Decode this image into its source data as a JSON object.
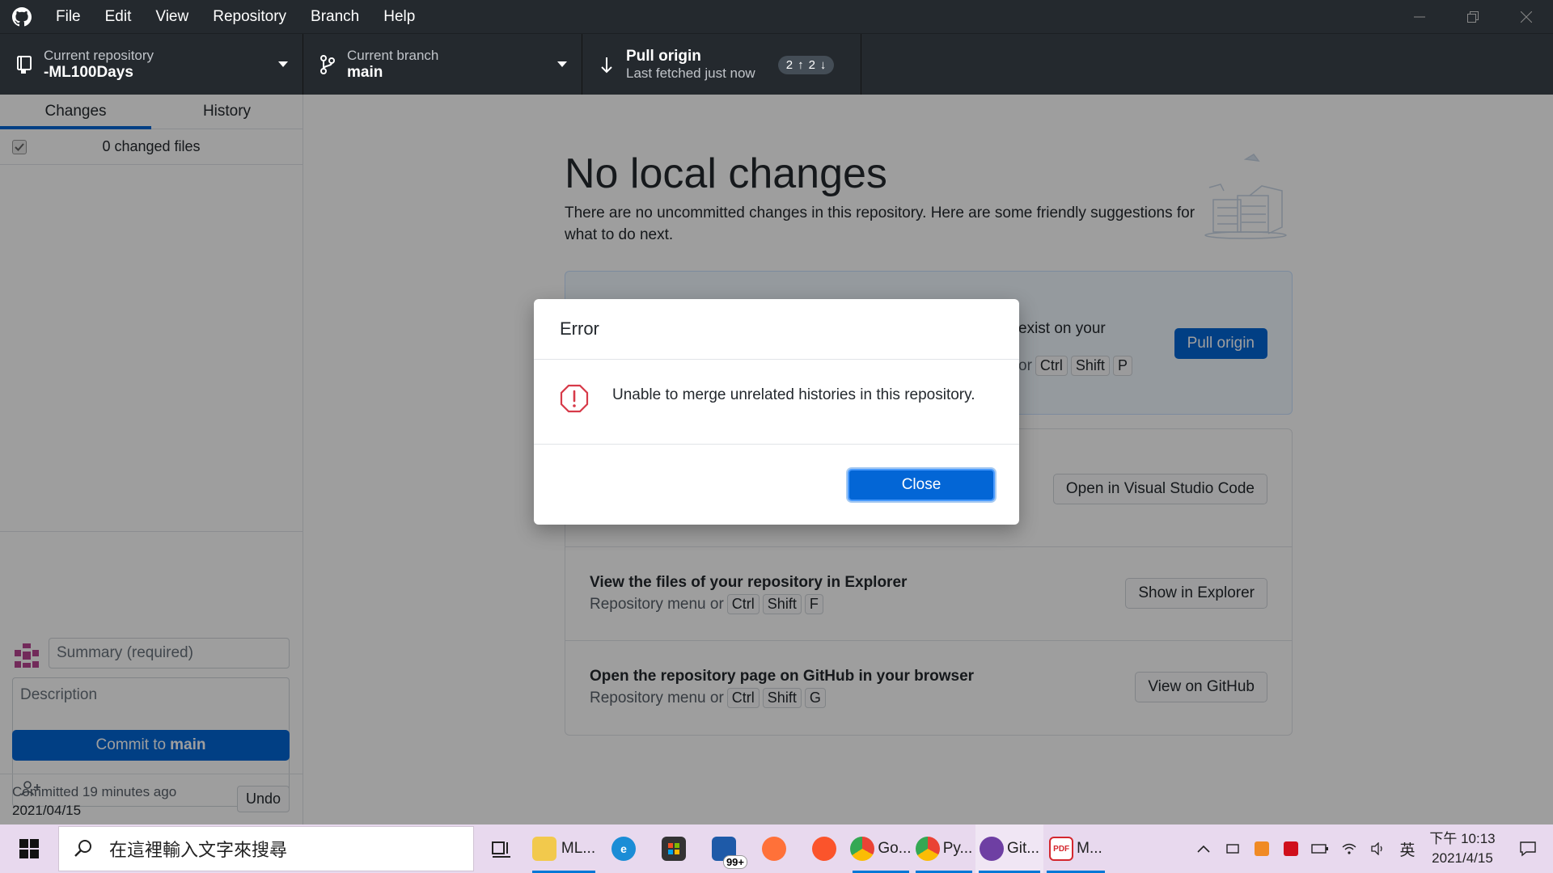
{
  "titlebar": {
    "menu": [
      "File",
      "Edit",
      "View",
      "Repository",
      "Branch",
      "Help"
    ]
  },
  "toolbar": {
    "repo_label": "Current repository",
    "repo_value": "-ML100Days",
    "branch_label": "Current branch",
    "branch_value": "main",
    "pull_label": "Pull origin",
    "pull_sub": "Last fetched just now",
    "ahead": "2",
    "behind": "2"
  },
  "sidebar": {
    "tabs": [
      "Changes",
      "History"
    ],
    "changed_files": "0 changed files",
    "summary_placeholder": "Summary (required)",
    "description_placeholder": "Description",
    "commit_prefix": "Commit to",
    "commit_branch": "main",
    "last_commit_text": "Committed 19 minutes ago",
    "last_commit_date": "2021/04/15",
    "undo_label": "Undo"
  },
  "main": {
    "title": "No local changes",
    "description": "There are no uncommitted changes in this repository. Here are some friendly suggestions for what to do next.",
    "pull_card": {
      "fragment": "exist on your",
      "or_text": "or",
      "keys": [
        "Ctrl",
        "Shift",
        "P"
      ],
      "button": "Pull origin"
    },
    "rows": [
      {
        "title": "",
        "sub_prefix": "",
        "keys": [],
        "button": "Open in Visual Studio Code"
      },
      {
        "title": "View the files of your repository in Explorer",
        "sub_prefix": "Repository menu or",
        "keys": [
          "Ctrl",
          "Shift",
          "F"
        ],
        "button": "Show in Explorer"
      },
      {
        "title": "Open the repository page on GitHub in your browser",
        "sub_prefix": "Repository menu or",
        "keys": [
          "Ctrl",
          "Shift",
          "G"
        ],
        "button": "View on GitHub"
      }
    ]
  },
  "dialog": {
    "title": "Error",
    "message": "Unable to merge unrelated histories in this repository.",
    "close_label": "Close"
  },
  "taskbar": {
    "search_placeholder": "在這裡輸入文字來搜尋",
    "apps": [
      {
        "name": "file-explorer",
        "label": "ML..."
      },
      {
        "name": "edge",
        "label": ""
      },
      {
        "name": "store",
        "label": ""
      },
      {
        "name": "mail",
        "label": "",
        "badge": "99+"
      },
      {
        "name": "firefox",
        "label": ""
      },
      {
        "name": "brave",
        "label": ""
      },
      {
        "name": "chrome-1",
        "label": "Go..."
      },
      {
        "name": "chrome-2",
        "label": "Py..."
      },
      {
        "name": "github-desktop",
        "label": "Git..."
      },
      {
        "name": "pdf",
        "label": "M..."
      }
    ],
    "ime": "英",
    "time": "下午 10:13",
    "date": "2021/4/15"
  },
  "colors": {
    "accent": "#0366d6",
    "titlebar_bg": "#24292e",
    "error": "#d73a49",
    "taskbar_bg": "#e8d9ee"
  }
}
